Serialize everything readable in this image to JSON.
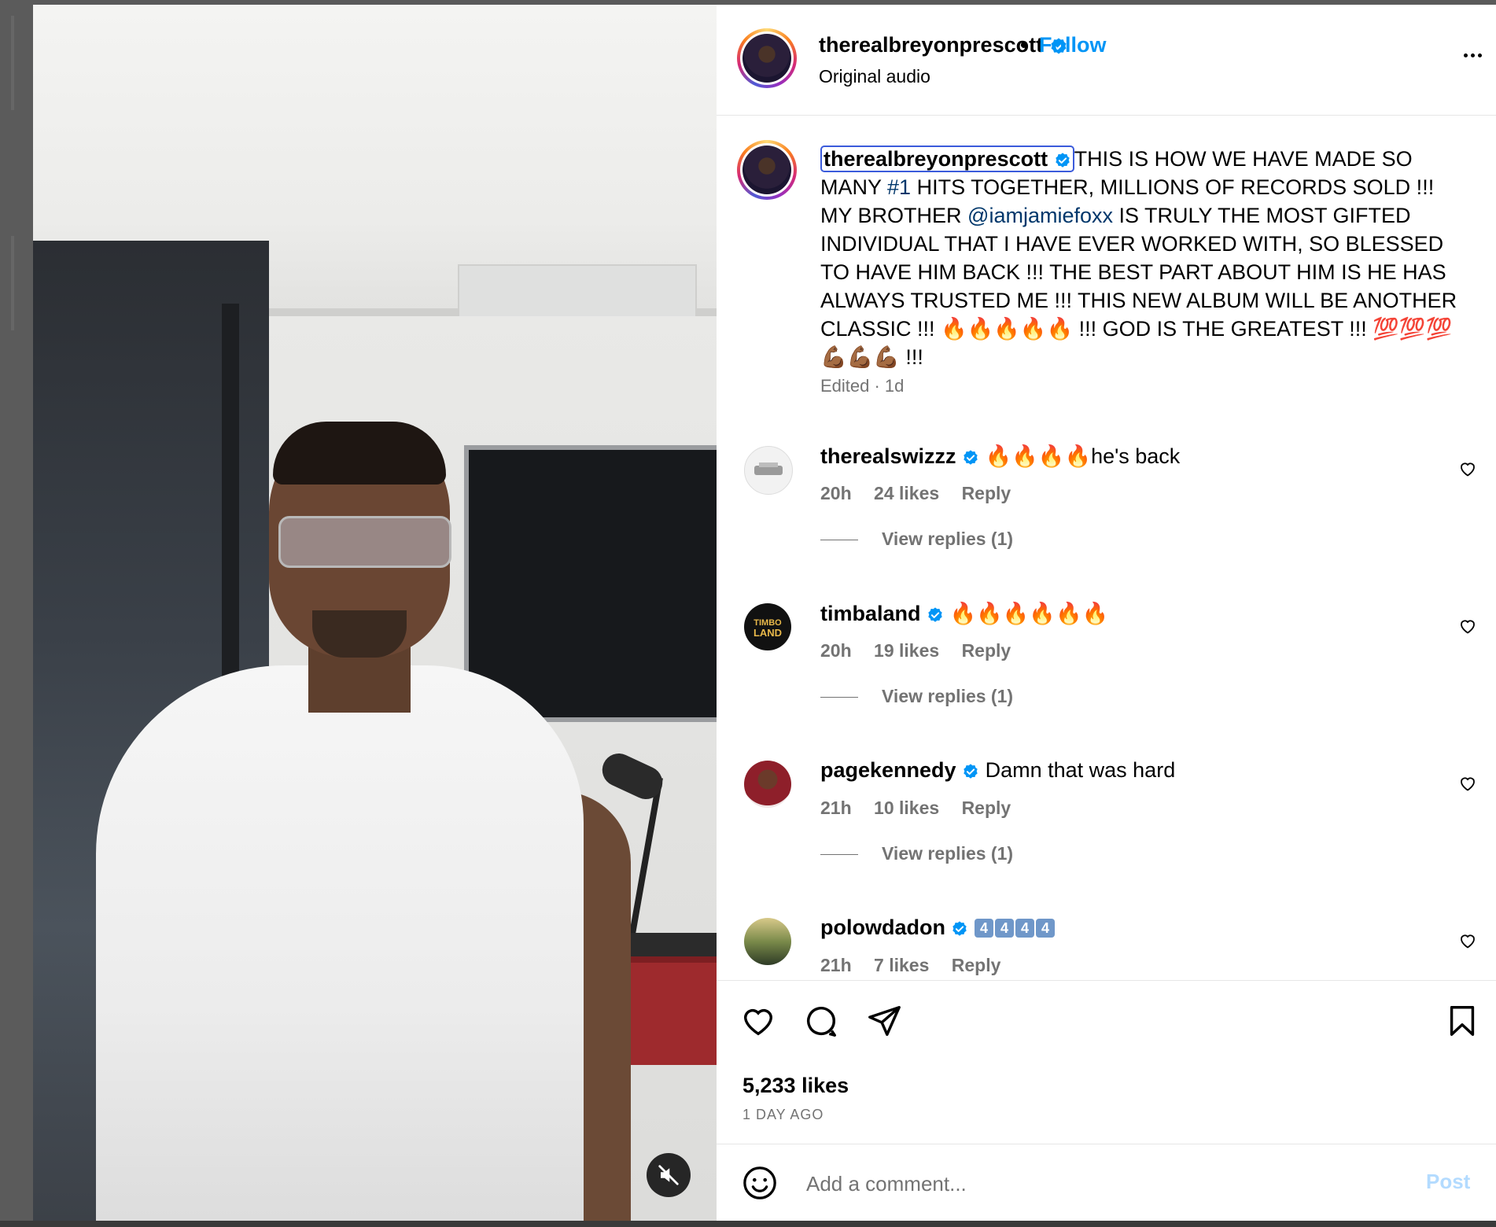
{
  "post": {
    "author": "therealbreyonprescott",
    "follow_label": "Follow",
    "separator": "•",
    "audio": "Original audio"
  },
  "caption": {
    "username": "therealbreyonprescott",
    "text_1": "THIS IS HOW WE HAVE MADE SO MANY ",
    "hashtag": "#1",
    "text_2": " HITS TOGETHER, MILLIONS OF RECORDS SOLD !!! MY BROTHER ",
    "mention": "@iamjamiefoxx",
    "text_3": " IS TRULY THE MOST GIFTED INDIVIDUAL THAT I HAVE EVER WORKED WITH, SO BLESSED TO HAVE HIM BACK !!! THE BEST PART ABOUT HIM IS HE HAS ALWAYS TRUSTED ME !!! THIS NEW ALBUM WILL BE ANOTHER CLASSIC !!! 🔥🔥🔥🔥🔥 !!! GOD IS THE GREATEST !!! 💯💯💯💪🏾💪🏾💪🏾 !!!",
    "edited": "Edited · 1d"
  },
  "comments": [
    {
      "user": "therealswizzz",
      "text": "🔥🔥🔥🔥he's back",
      "time": "20h",
      "likes": "24 likes",
      "reply": "Reply",
      "view_replies": "View replies (1)"
    },
    {
      "user": "timbaland",
      "text": "🔥🔥🔥🔥🔥🔥",
      "time": "20h",
      "likes": "19 likes",
      "reply": "Reply",
      "view_replies": "View replies (1)",
      "avatar_text": "TIMBO LAND"
    },
    {
      "user": "pagekennedy",
      "text": "Damn that was hard",
      "time": "21h",
      "likes": "10 likes",
      "reply": "Reply",
      "view_replies": "View replies (1)"
    },
    {
      "user": "polowdadon",
      "keycaps": [
        "4",
        "4",
        "4",
        "4"
      ],
      "time": "21h",
      "likes": "7 likes",
      "reply": "Reply"
    }
  ],
  "stats": {
    "likes": "5,233 likes",
    "time_ago": "1 DAY AGO"
  },
  "composer": {
    "placeholder": "Add a comment...",
    "post_label": "Post"
  },
  "colors": {
    "accent": "#0095f6",
    "muted": "#737373",
    "link": "#00376b",
    "post_disabled": "#b3dbff"
  },
  "icons": [
    "verified-badge-icon",
    "more-options-icon",
    "heart-icon",
    "comment-icon",
    "share-icon",
    "bookmark-icon",
    "emoji-icon",
    "muted-speaker-icon"
  ]
}
